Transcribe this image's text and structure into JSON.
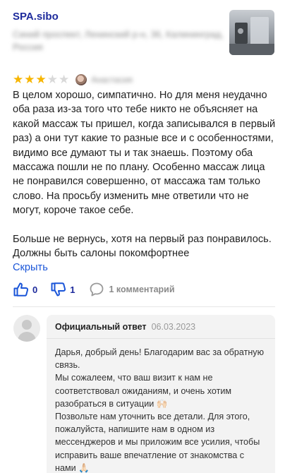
{
  "business": {
    "name": "SPA.sibo",
    "address": "Синий проспект, Ленинский р-н, 36, Калининград, Россия"
  },
  "review": {
    "rating": 3,
    "rating_max": 5,
    "author": "Анастасия",
    "text": "В целом хорошо, симпатично. Но для меня неудачно оба раза из-за того что тебе никто не объясняет на какой массаж ты пришел, когда записывался в первый раз) а они тут какие то разные все и с особенностями, видимо все думают ты и так знаешь. Поэтому оба массажа пошли не по плану. Особенно массаж лица не понравился совершенно, от массажа там только слово. На просьбу изменить мне ответили что не могут, короче такое себе.\n\nБольше не вернусь, хотя на первый раз понравилось. Должны быть салоны покомфортнее",
    "collapse_label": "Скрыть",
    "likes": "0",
    "dislikes": "1",
    "comments_label": "1 комментарий"
  },
  "reply": {
    "title": "Официальный ответ",
    "date": "06.03.2023",
    "text": "Дарья, добрый день! Благодарим вас за обратную связь.\nМы сожалеем, что ваш визит к нам не соответствовал ожиданиям, и очень хотим разобраться в ситуации 🙌🏻\nПозвольте нам уточнить все детали. Для этого, пожалуйста, напишите нам в одном из мессенджеров и мы приложим все усилия, чтобы исправить ваше впечатление от знакомства с нами 🙏🏻"
  },
  "colors": {
    "accent": "#1a55d8",
    "brand_text": "#1d2a9c",
    "star_on": "#f7b500",
    "star_off": "#d9d9d9"
  },
  "icons": {
    "like": "thumbs-up-icon",
    "dislike": "thumbs-down-icon",
    "comments": "speech-bubble-icon"
  }
}
